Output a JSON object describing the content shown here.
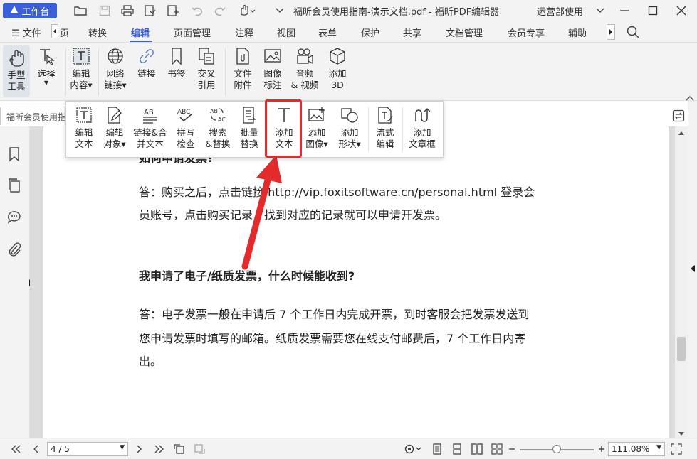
{
  "titlebar": {
    "workbench_label": "工作台",
    "doc_title": "福昕会员使用指南-演示文档.pdf - 福昕PDF编辑器",
    "user_label": "运营部使用"
  },
  "menu": {
    "file_label": "文件",
    "partial_tab": "页",
    "tabs": [
      "转换",
      "编辑",
      "页面管理",
      "注释",
      "视图",
      "表单",
      "保护",
      "共享",
      "文档管理",
      "会员专享",
      "辅助"
    ],
    "active_tab": "编辑"
  },
  "ribbon": {
    "hand_tool": "手型\n工具",
    "select": "选择",
    "edit_content": "编辑\n内容",
    "web_link": "网络\n链接",
    "link": "链接",
    "bookmark": "书签",
    "cross_ref": "交叉\n引用",
    "file_attach": "文件\n附件",
    "image_annot": "图像\n标注",
    "audio_video": "音频\n& 视频",
    "add_3d": "添加\n3D"
  },
  "doctab": {
    "label": "福昕会员使用指"
  },
  "dropdown": {
    "edit_text": "编辑\n文本",
    "edit_object": "编辑\n对象",
    "link_merge": "链接&合\n并文本",
    "spell_check": "拼写\n检查",
    "search_replace": "搜索\n&替换",
    "batch_replace": "批量\n替换",
    "add_text": "添加\n文本",
    "add_image": "添加\n图像",
    "add_shape": "添加\n形状",
    "flow_edit": "流式\n编辑",
    "add_textbox": "添加\n文章框"
  },
  "document": {
    "partial_heading": "如何申请发票?",
    "answer1_line1": "答：购买之后，点击链接 http://vip.foxitsoftware.cn/personal.html 登录会",
    "answer1_line2": "员账号，点击购买记录，找到对应的记录就可以申请开发票。",
    "question2": "我申请了电子/纸质发票，什么时候能收到?",
    "answer2_line1": "答：电子发票一般在申请后 7 个工作日内完成开票，到时客服会把发票发送到",
    "answer2_line2": "您申请发票时填写的邮箱。纸质发票需要您在线支付邮费后，7 个工作日内寄",
    "answer2_line3": "出。"
  },
  "statusbar": {
    "page_value": "4 / 5",
    "zoom_value": "111.08%"
  },
  "colors": {
    "accent": "#3b5fd9",
    "highlight": "#e42b2b"
  }
}
